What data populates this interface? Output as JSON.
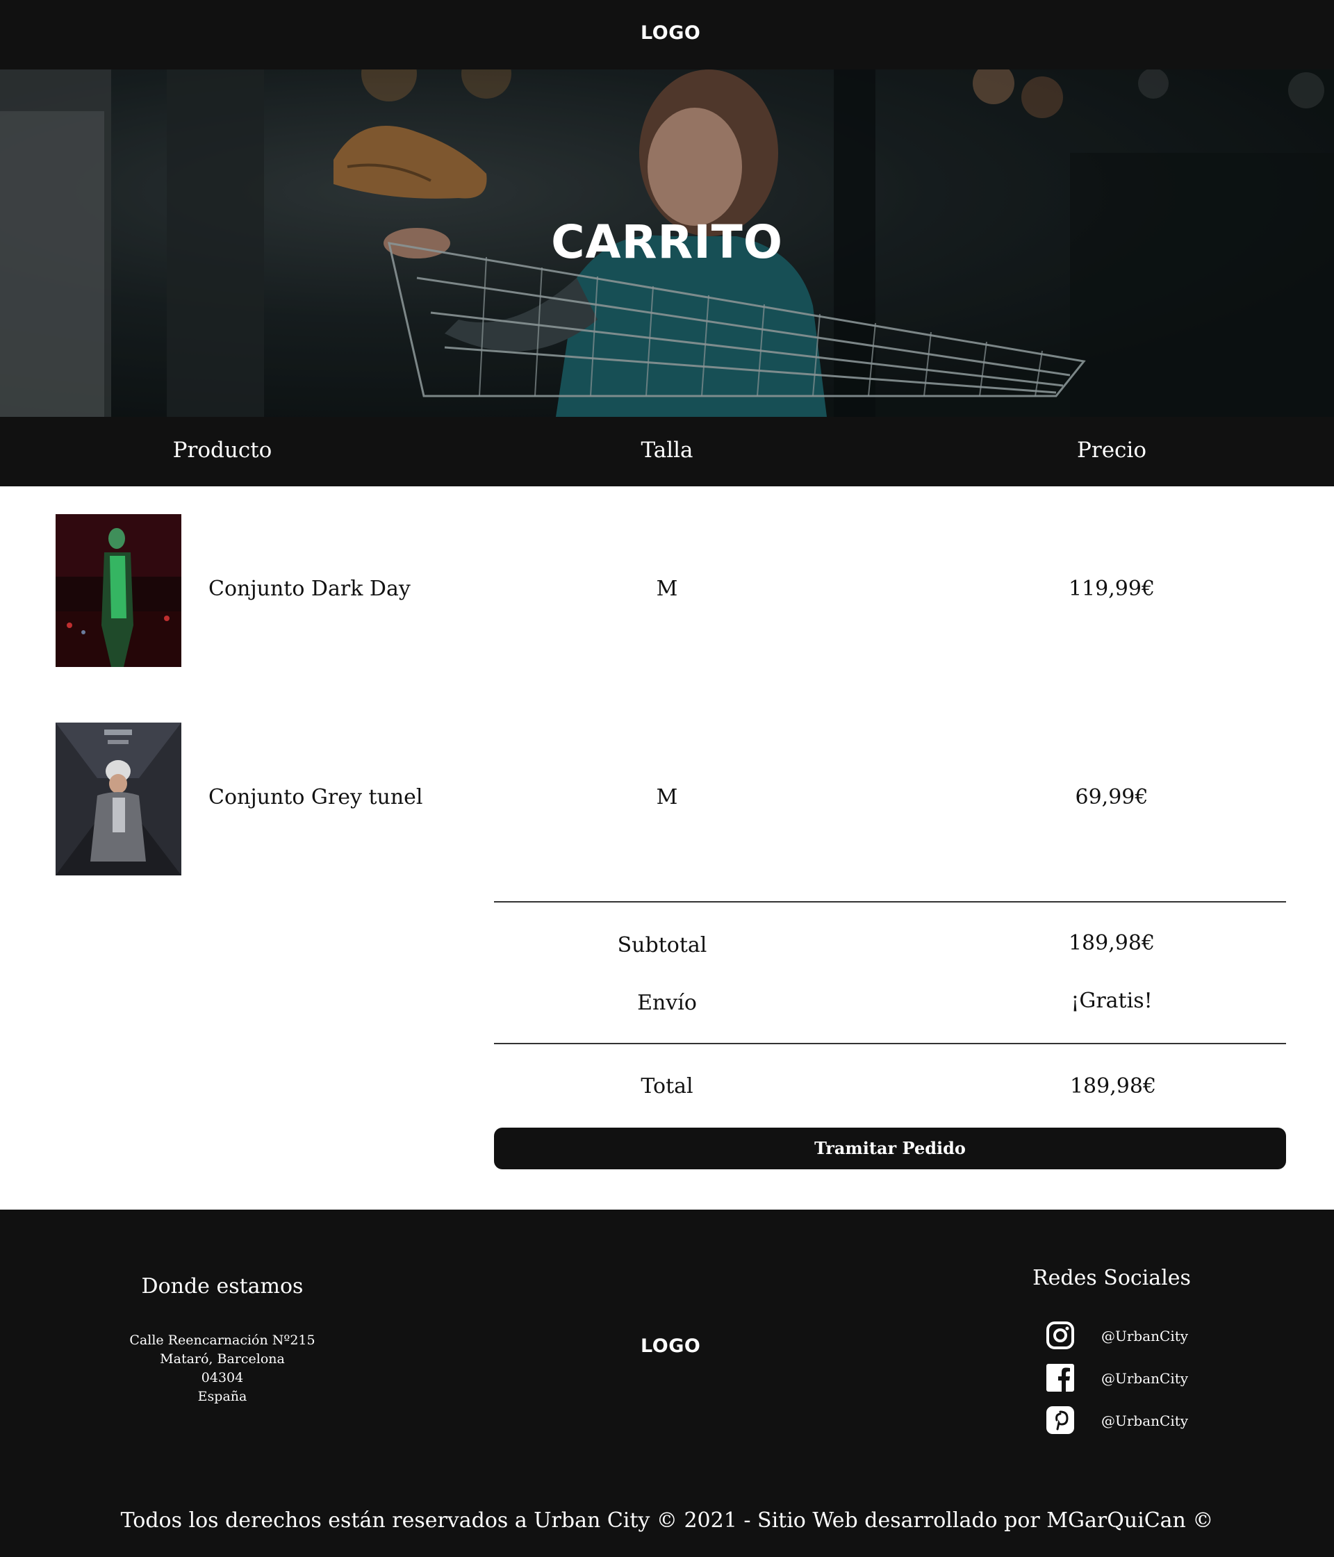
{
  "header": {
    "logo": "LOGO"
  },
  "hero": {
    "title": "CARRITO"
  },
  "table": {
    "columns": [
      "Producto",
      "Talla",
      "Precio"
    ],
    "rows": [
      {
        "name": "Conjunto Dark Day",
        "size": "M",
        "price": "119,99€"
      },
      {
        "name": "Conjunto Grey tunel",
        "size": "M",
        "price": "69,99€"
      }
    ]
  },
  "summary": {
    "subtotal_label": "Subtotal",
    "subtotal_value": "189,98€",
    "shipping_label": "Envío",
    "shipping_value": "¡Gratis!",
    "total_label": "Total",
    "total_value": "189,98€",
    "checkout_button": "Tramitar Pedido"
  },
  "footer": {
    "location_title": "Donde estamos",
    "address": [
      "Calle Reencarnación Nº215",
      "Mataró, Barcelona",
      "04304",
      "España"
    ],
    "logo": "LOGO",
    "social_title": "Redes Sociales",
    "social": [
      {
        "icon": "instagram-icon",
        "handle": "@UrbanCity"
      },
      {
        "icon": "facebook-icon",
        "handle": "@UrbanCity"
      },
      {
        "icon": "pinterest-icon",
        "handle": "@UrbanCity"
      }
    ],
    "copyright": "Todos los derechos están reservados a Urban City © 2021  - Sitio Web desarrollado por MGarQuiCan ©"
  },
  "colors": {
    "dark": "#111111",
    "background": "#ffffff",
    "text": "#111111"
  }
}
